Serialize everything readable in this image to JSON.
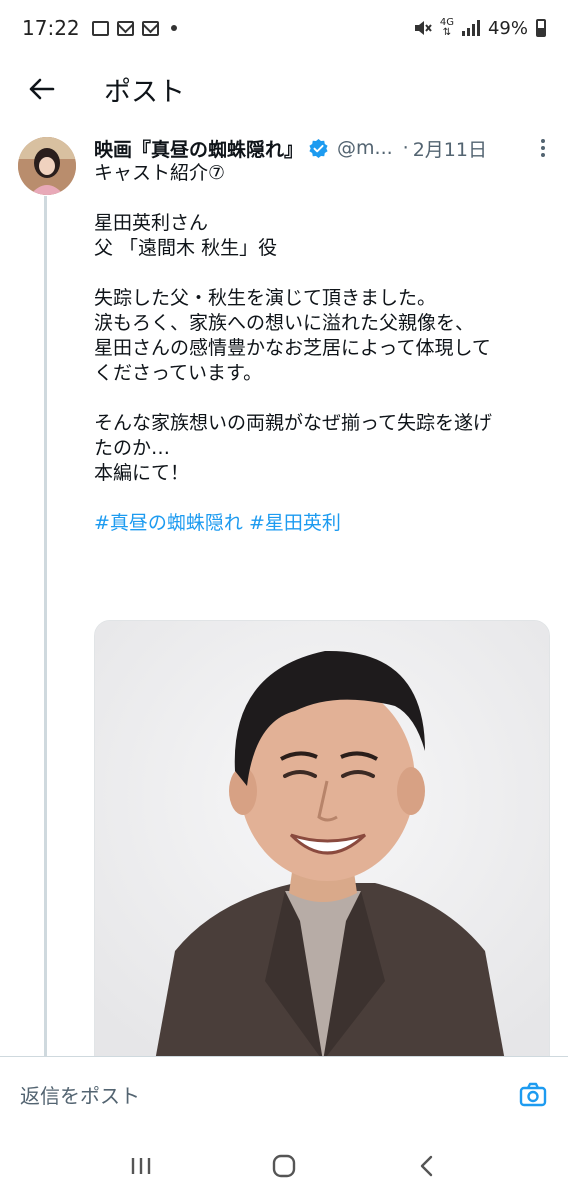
{
  "status_bar": {
    "time": "17:22",
    "network": "4G",
    "battery": "49%"
  },
  "header": {
    "title": "ポスト"
  },
  "tweet": {
    "display_name": "映画『真昼の蜘蛛隠れ』",
    "handle": "@m...",
    "separator": "·",
    "date": "2月11日",
    "lines": [
      "キャスト紹介⑦",
      "",
      "星田英利さん",
      "父 「遠間木 秋生」役",
      "",
      "失踪した父・秋生を演じて頂きました。",
      "涙もろく、家族への想いに溢れた父親像を、",
      "星田さんの感情豊かなお芝居によって体現して",
      "くださっています。",
      "",
      "そんな家族想いの両親がなぜ揃って失踪を遂げ",
      "たのか…",
      "本編にて！",
      ""
    ],
    "hashtags": [
      "#真昼の蜘蛛隠れ",
      "#星田英利"
    ]
  },
  "reply": {
    "placeholder": "返信をポスト"
  },
  "colors": {
    "accent": "#1d9bf0",
    "text": "#0f1419",
    "muted": "#536471"
  }
}
